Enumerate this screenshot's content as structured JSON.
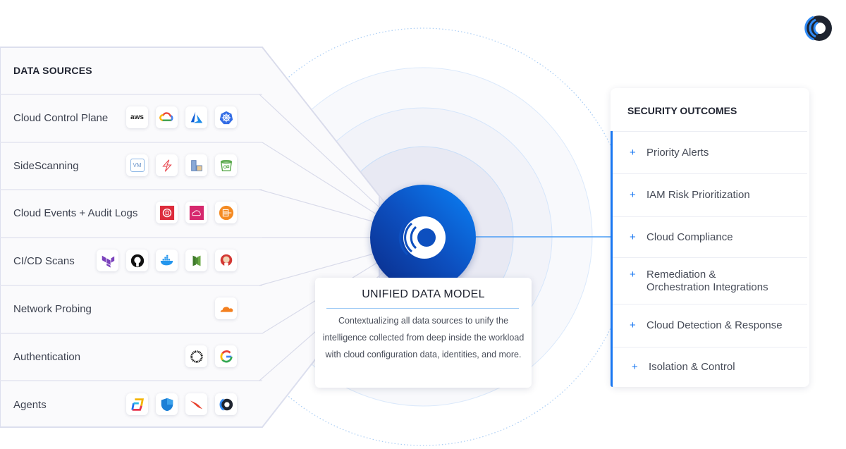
{
  "data_sources": {
    "title": "DATA SOURCES",
    "rows": [
      {
        "label": "Cloud Control Plane",
        "icons": [
          "aws-icon",
          "google-cloud-icon",
          "azure-icon",
          "kubernetes-icon"
        ]
      },
      {
        "label": "SideScanning",
        "icons": [
          "vm-icon",
          "serverless-icon",
          "container-icon",
          "storage-bucket-icon"
        ]
      },
      {
        "label": "Cloud Events + Audit Logs",
        "icons": [
          "cloudtrail-icon",
          "cloudwatch-icon",
          "log-stream-icon"
        ]
      },
      {
        "label": "CI/CD Scans",
        "icons": [
          "terraform-icon",
          "github-icon",
          "docker-icon",
          "codecommit-icon",
          "jenkins-icon"
        ]
      },
      {
        "label": "Network Probing",
        "icons": [
          "cloudflare-icon"
        ]
      },
      {
        "label": "Authentication",
        "icons": [
          "okta-icon",
          "google-icon"
        ]
      },
      {
        "label": "Agents",
        "icons": [
          "sentinelone-icon",
          "defender-icon",
          "crowdstrike-icon",
          "orca-agent-icon"
        ]
      }
    ],
    "aws_text": "aws",
    "vm_text": "VM"
  },
  "unified_data_model": {
    "title": "UNIFIED DATA MODEL",
    "description": "Contextualizing all data sources to  unify the intelligence collected from deep inside the workload with cloud configuration data, identities, and more."
  },
  "security_outcomes": {
    "title": "SECURITY OUTCOMES",
    "plus": "+",
    "items": [
      {
        "label": "Priority Alerts"
      },
      {
        "label": "IAM Risk Prioritization"
      },
      {
        "label": "Cloud Compliance"
      },
      {
        "label": "Remediation & Orchestration Integrations"
      },
      {
        "label": "Cloud Detection & Response"
      },
      {
        "label": "Isolation & Control"
      }
    ]
  },
  "colors": {
    "accent": "#1877f2",
    "brand_dark": "#0a2a86",
    "ring": "#d6e6fb"
  }
}
